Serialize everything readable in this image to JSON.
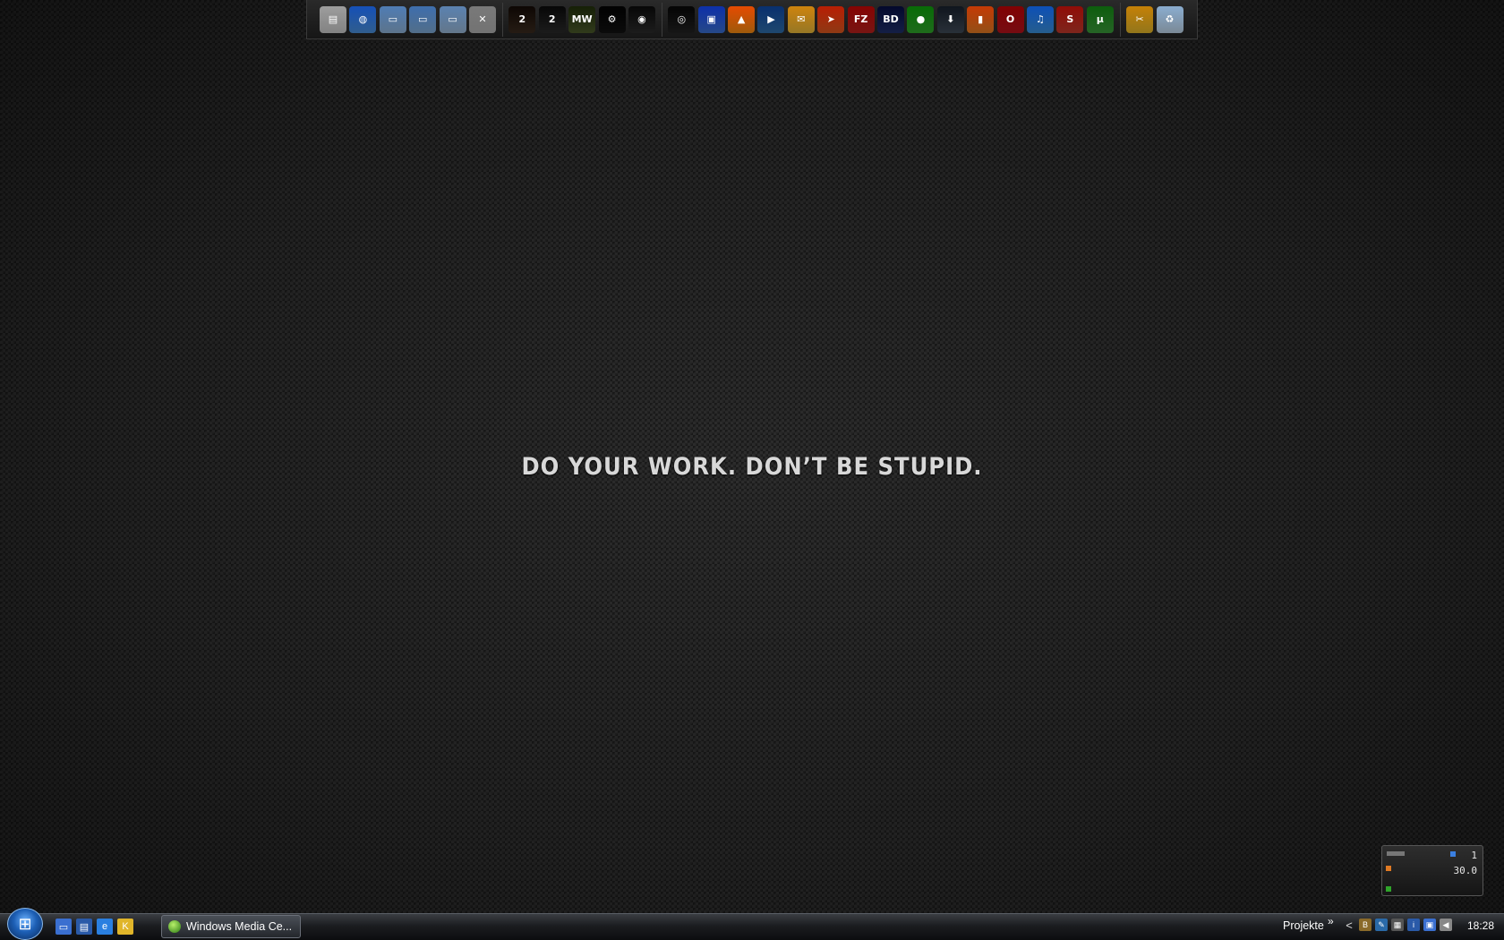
{
  "desktop": {
    "motto": "DO YOUR WORK. DON’T BE STUPID."
  },
  "dock": {
    "groups": [
      [
        {
          "name": "document-icon",
          "color": "#c8c8c8",
          "glyph": "▤"
        },
        {
          "name": "network-globe-icon",
          "color": "#4a8fd8",
          "glyph": "◍"
        },
        {
          "name": "folder-icon",
          "color": "#8eb2d6",
          "glyph": "▭"
        },
        {
          "name": "folder-open-icon",
          "color": "#7ea8d2",
          "glyph": "▭"
        },
        {
          "name": "folder-documents-icon",
          "color": "#98b6d4",
          "glyph": "▭"
        },
        {
          "name": "cleanup-icon",
          "color": "#b0b0b0",
          "glyph": "✕"
        }
      ],
      [
        {
          "name": "battlefield-2-icon",
          "color": "#3a2a1e",
          "glyph": "2"
        },
        {
          "name": "battlefield-2142-icon",
          "color": "#2a2a2a",
          "glyph": "2"
        },
        {
          "name": "nfs-most-wanted-icon",
          "color": "#4b5a2a",
          "glyph": "MW"
        },
        {
          "name": "steam-icon",
          "color": "#111111",
          "glyph": "⚙"
        },
        {
          "name": "disc-icon",
          "color": "#2b2b2b",
          "glyph": "◉"
        }
      ],
      [
        {
          "name": "eye-icon",
          "color": "#222222",
          "glyph": "◎"
        },
        {
          "name": "floppy-save-icon",
          "color": "#3a6fd0",
          "glyph": "▣"
        },
        {
          "name": "vlc-icon",
          "color": "#f28a11",
          "glyph": "▲"
        },
        {
          "name": "media-player-icon",
          "color": "#2f6ea8",
          "glyph": "▶"
        },
        {
          "name": "outlook-icon",
          "color": "#e5b73a",
          "glyph": "✉"
        },
        {
          "name": "paper-plane-icon",
          "color": "#d9581f",
          "glyph": "➤"
        },
        {
          "name": "filezilla-icon",
          "color": "#b8201c",
          "glyph": "FZ"
        },
        {
          "name": "bd-icon",
          "color": "#1f2f6a",
          "glyph": "BD"
        },
        {
          "name": "green-orb-icon",
          "color": "#2fa52a",
          "glyph": "●"
        },
        {
          "name": "download-icon",
          "color": "#3f4a57",
          "glyph": "⬇"
        },
        {
          "name": "orange-panel-icon",
          "color": "#e07a23",
          "glyph": "▮"
        },
        {
          "name": "opera-icon",
          "color": "#b5121b",
          "glyph": "O"
        },
        {
          "name": "itunes-icon",
          "color": "#3a8fd8",
          "glyph": "♫"
        },
        {
          "name": "script-icon",
          "color": "#c0392b",
          "glyph": "S"
        },
        {
          "name": "utorrent-icon",
          "color": "#3a9a3a",
          "glyph": "µ"
        }
      ],
      [
        {
          "name": "tools-icon",
          "color": "#e0b52a",
          "glyph": "✂"
        },
        {
          "name": "recycle-bin-icon",
          "color": "#bcd2e6",
          "glyph": "♻"
        }
      ]
    ]
  },
  "taskbar": {
    "quick_launch": [
      {
        "name": "show-desktop-icon",
        "color": "#3a6fd0",
        "glyph": "▭"
      },
      {
        "name": "switch-windows-icon",
        "color": "#2a5aa8",
        "glyph": "▤"
      },
      {
        "name": "internet-explorer-icon",
        "color": "#2a7fe0",
        "glyph": "e"
      },
      {
        "name": "quicklaunch-app-icon",
        "color": "#e0b52a",
        "glyph": "K"
      }
    ],
    "task_button_label": "Windows Media Ce...",
    "toolbar_label": "Projekte",
    "toolbar_chevron": "»",
    "tray_expand": "<",
    "tray_icons": [
      {
        "name": "tray-app-icon",
        "color": "#8a6a2a",
        "glyph": "B"
      },
      {
        "name": "tray-network-tool-icon",
        "color": "#2a6aa8",
        "glyph": "✎"
      },
      {
        "name": "tray-grid-icon",
        "color": "#555555",
        "glyph": "▦"
      },
      {
        "name": "tray-update-icon",
        "color": "#2a5aa8",
        "glyph": "i"
      },
      {
        "name": "tray-network-icon",
        "color": "#3a6fd0",
        "glyph": "▣"
      },
      {
        "name": "tray-volume-icon",
        "color": "#888888",
        "glyph": "◀"
      }
    ],
    "clock": "18:28"
  },
  "gadget": {
    "line1": "1",
    "line2": "30.0"
  }
}
